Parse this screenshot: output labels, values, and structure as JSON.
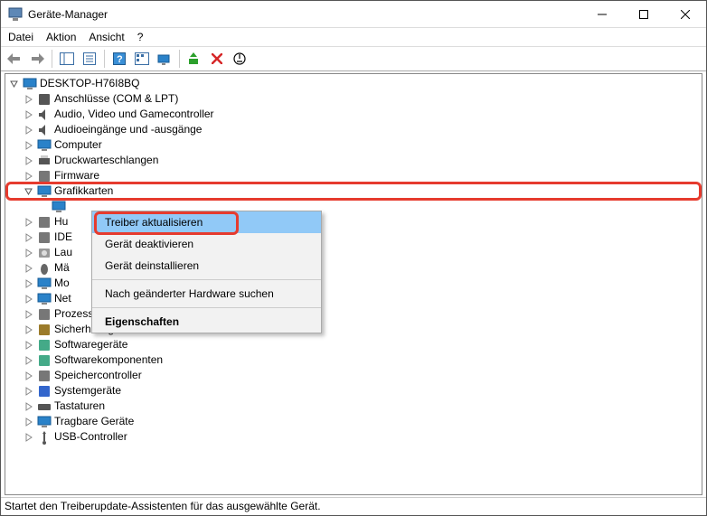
{
  "window": {
    "title": "Geräte-Manager"
  },
  "menubar": {
    "items": [
      "Datei",
      "Aktion",
      "Ansicht",
      "?"
    ]
  },
  "tree": {
    "root": "DESKTOP-H76I8BQ",
    "nodes": [
      {
        "label": "Anschlüsse (COM & LPT)",
        "icon": "port"
      },
      {
        "label": "Audio, Video und Gamecontroller",
        "icon": "audio"
      },
      {
        "label": "Audioeingänge und -ausgänge",
        "icon": "audio"
      },
      {
        "label": "Computer",
        "icon": "monitor"
      },
      {
        "label": "Druckwarteschlangen",
        "icon": "printer"
      },
      {
        "label": "Firmware",
        "icon": "chip"
      },
      {
        "label": "Grafikkarten",
        "icon": "monitor",
        "expanded": true,
        "highlight": true
      },
      {
        "label": "",
        "icon": "monitor",
        "child": true
      },
      {
        "label": "Hu",
        "icon": "hid"
      },
      {
        "label": "IDE",
        "icon": "storage"
      },
      {
        "label": "Lau",
        "icon": "disk"
      },
      {
        "label": "Mä",
        "icon": "mouse"
      },
      {
        "label": "Mo",
        "icon": "monitor"
      },
      {
        "label": "Net",
        "icon": "network"
      },
      {
        "label": "Prozessoren",
        "icon": "cpu"
      },
      {
        "label": "Sicherheitsgeräte",
        "icon": "security"
      },
      {
        "label": "Softwaregeräte",
        "icon": "software"
      },
      {
        "label": "Softwarekomponenten",
        "icon": "software"
      },
      {
        "label": "Speichercontroller",
        "icon": "storage"
      },
      {
        "label": "Systemgeräte",
        "icon": "system"
      },
      {
        "label": "Tastaturen",
        "icon": "keyboard"
      },
      {
        "label": "Tragbare Geräte",
        "icon": "portable"
      },
      {
        "label": "USB-Controller",
        "icon": "usb"
      }
    ]
  },
  "context_menu": {
    "items": [
      "Treiber aktualisieren",
      "Gerät deaktivieren",
      "Gerät deinstallieren",
      "-",
      "Nach geänderter Hardware suchen",
      "-",
      "Eigenschaften"
    ]
  },
  "statusbar": {
    "text": "Startet den Treiberupdate-Assistenten für das ausgewählte Gerät."
  }
}
